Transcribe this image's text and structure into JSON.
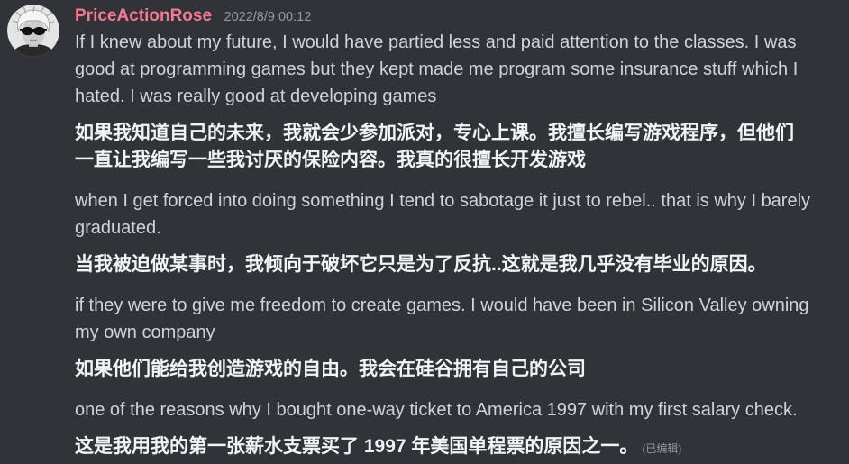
{
  "message": {
    "author": {
      "name": "PriceActionRose",
      "color": "#f47b8f",
      "avatar_icon": "user-avatar"
    },
    "timestamp": "2022/8/9 00:12"
  },
  "messages": [
    {
      "lang": "en",
      "text": "If I knew about my future, I would have partied less and paid attention to the classes. I was good at programming games but they kept made me program some insurance stuff which I hated. I was really good at developing games"
    },
    {
      "lang": "zh",
      "text": "如果我知道自己的未来，我就会少参加派对，专心上课。我擅长编写游戏程序，但他们一直让我编写一些我讨厌的保险内容。我真的很擅长开发游戏"
    },
    {
      "lang": "en",
      "text": "when I get forced into doing something I tend to sabotage it just to rebel.. that is why I barely graduated."
    },
    {
      "lang": "zh",
      "text": "当我被迫做某事时，我倾向于破坏它只是为了反抗..这就是我几乎没有毕业的原因。"
    },
    {
      "lang": "en",
      "text": "if they were to give me freedom to create games. I would have been in Silicon Valley owning my own company"
    },
    {
      "lang": "zh",
      "text": "如果他们能给我创造游戏的自由。我会在硅谷拥有自己的公司"
    },
    {
      "lang": "en",
      "text": "one of the reasons why I bought one-way ticket to America 1997 with my first salary check."
    },
    {
      "lang": "zh",
      "text": "这是我用我的第一张薪水支票买了 1997 年美国单程票的原因之一。",
      "edited_label": "(已编辑)"
    }
  ],
  "colors": {
    "background": "#313338",
    "text_en": "#d0d3d7",
    "text_zh": "#f2f3f5",
    "muted": "#949ba4"
  }
}
